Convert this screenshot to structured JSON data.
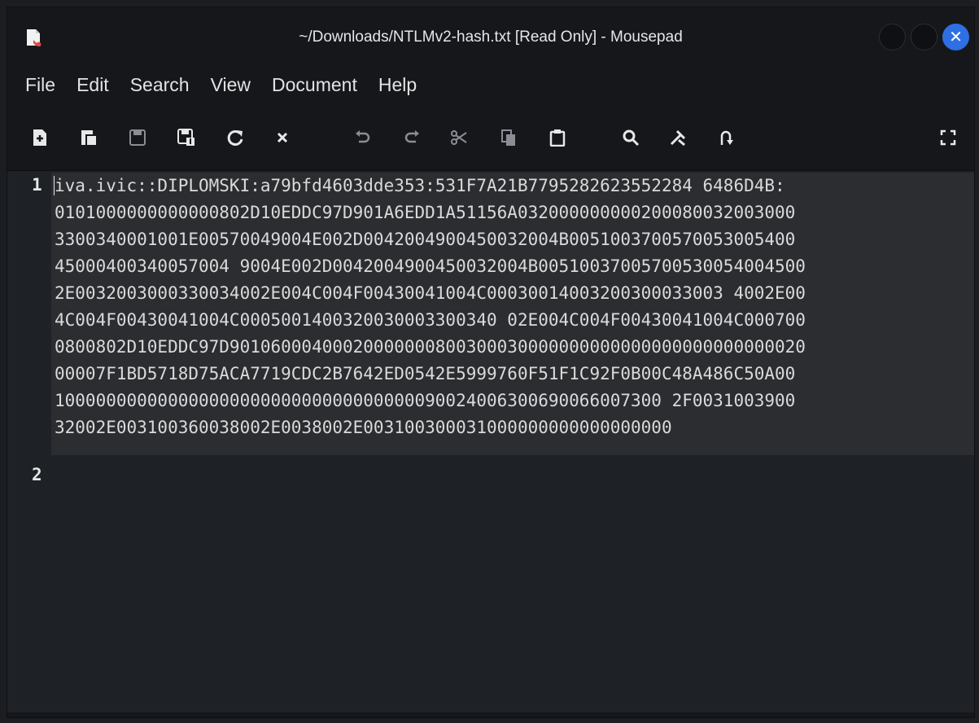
{
  "window": {
    "title": "~/Downloads/NTLMv2-hash.txt [Read Only] - Mousepad",
    "close_label": "✕"
  },
  "menu": [
    "File",
    "Edit",
    "Search",
    "View",
    "Document",
    "Help"
  ],
  "toolbar": {
    "icons": [
      "new-document-icon",
      "new-window-icon",
      "save-icon",
      "save-as-icon",
      "reload-icon",
      "close-document-icon",
      "undo-icon",
      "redo-icon",
      "cut-icon",
      "copy-icon",
      "paste-icon",
      "find-icon",
      "find-replace-icon",
      "goto-line-icon",
      "fullscreen-icon"
    ]
  },
  "editor": {
    "line_numbers": [
      "1",
      "2"
    ],
    "wrapped_lines": [
      "iva.ivic::DIPLOMSKI:a79bfd4603dde353:531F7A21B7795282623552284 6486D4B:",
      "0101000000000000802D10EDDC97D901A6EDD1A51156A032000000000200080032003000",
      "3300340001001E00570049004E002D0042004900450032004B0051003700570053005400",
      "45000400340057004 9004E002D0042004900450032004B00510037005700530054004500",
      "2E0032003000330034002E004C004F00430041004C00030014003200300033003 4002E00",
      "4C004F00430041004C0005001400320030003300340 02E004C004F00430041004C000700",
      "0800802D10EDDC97D90106000400020000000800300030000000000000000000000000020",
      "00007F1BD5718D75ACA7719CDC2B7642ED0542E5999760F51F1C92F0B00C48A486C50A00",
      "10000000000000000000000000000000000090024006300690066007300 2F0031003900",
      "32002E003100360038002E0038002E003100300031000000000000000000"
    ]
  },
  "colors": {
    "accent_close": "#2f6fe4",
    "editor_bg": "#1e2126",
    "chrome_bg": "#15171b"
  }
}
